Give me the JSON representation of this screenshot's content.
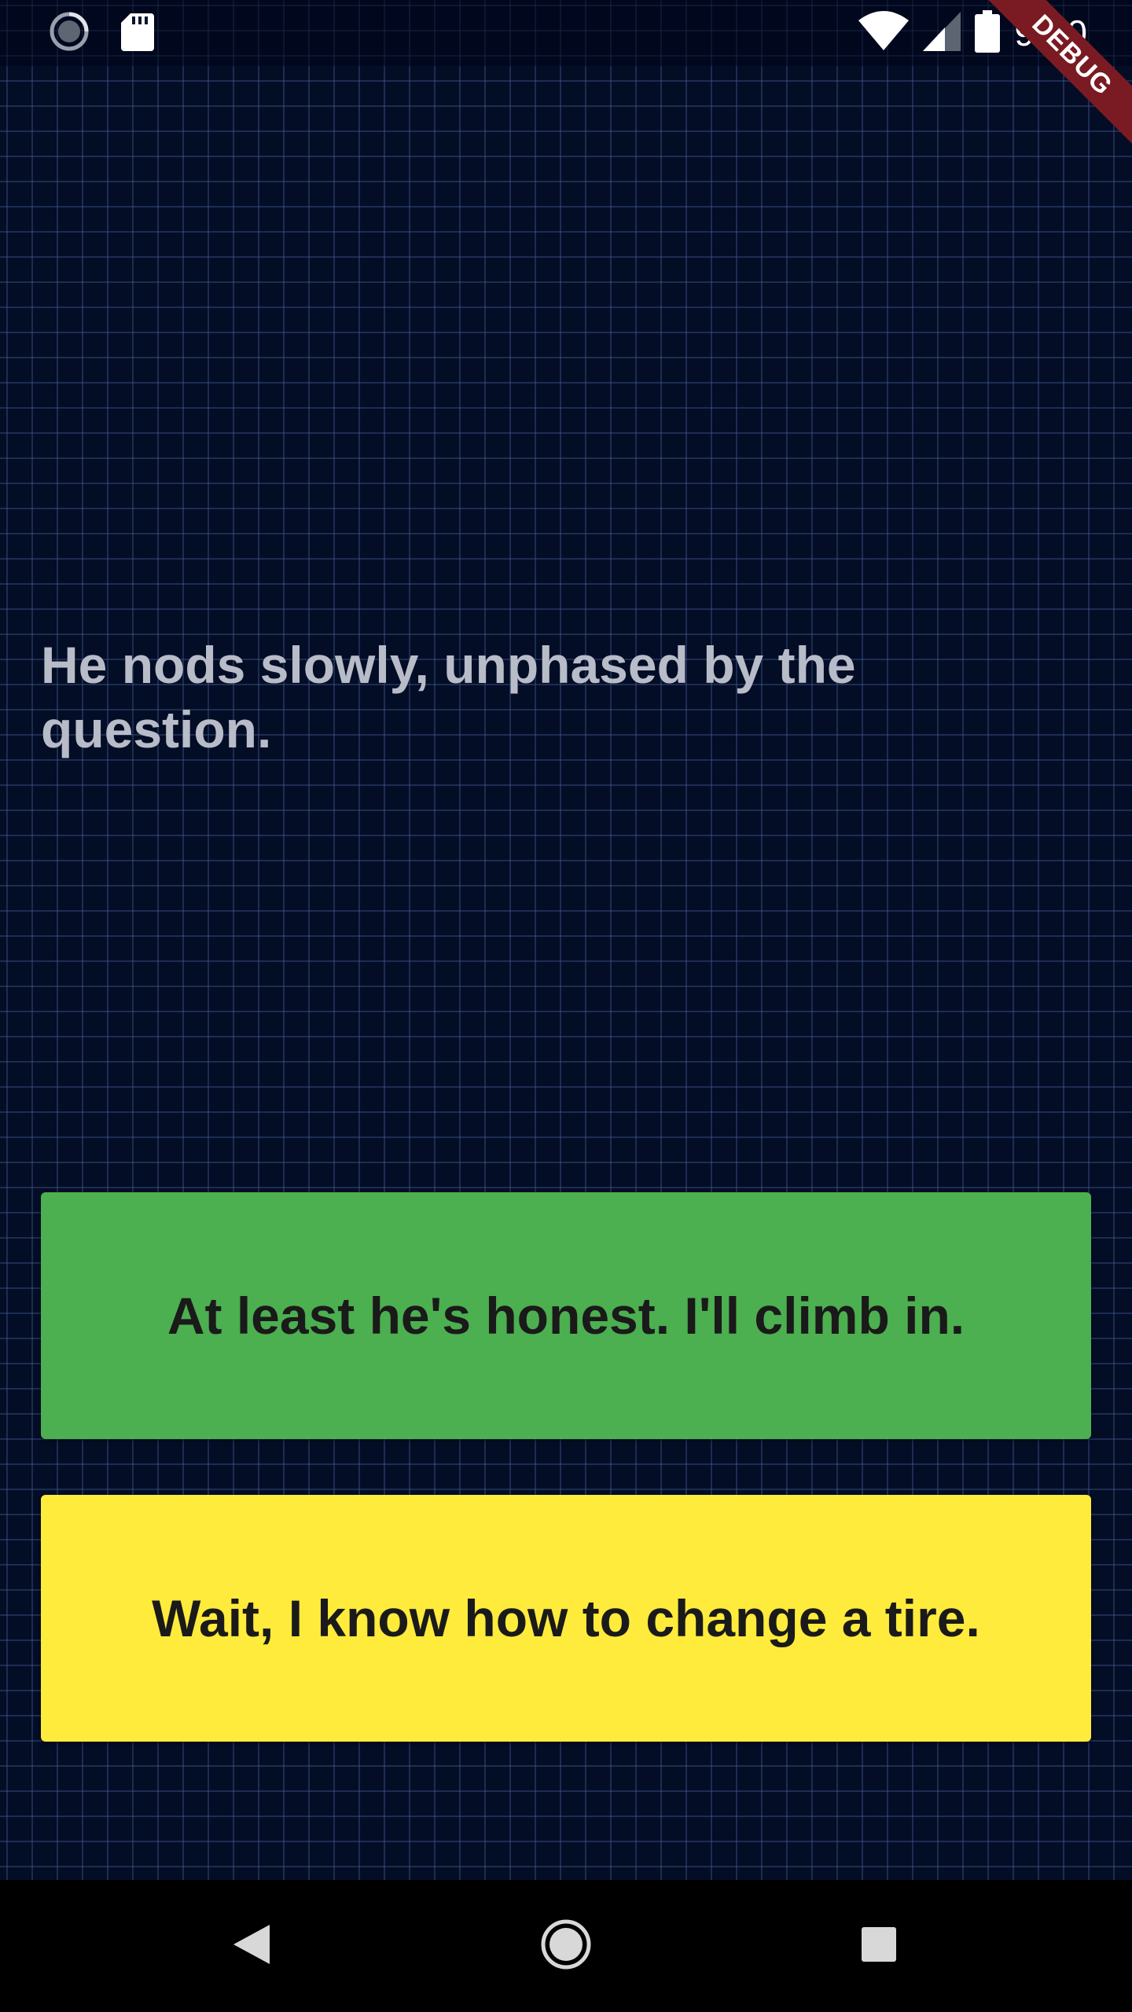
{
  "status_bar": {
    "time": "9:10",
    "icons": [
      "sync-icon",
      "sd-card-icon",
      "wifi-icon",
      "signal-icon",
      "battery-icon"
    ]
  },
  "debug_banner": {
    "label": "DEBUG",
    "color": "#7a1a22"
  },
  "story": {
    "text": "He nods slowly, unphased by the question."
  },
  "choices": [
    {
      "label": "At least he's honest. I'll climb in.",
      "color": "#4caf50"
    },
    {
      "label": "Wait, I know how to change a tire.",
      "color": "#ffeb3b"
    }
  ],
  "navigation": {
    "buttons": [
      "back-icon",
      "home-icon",
      "recents-icon"
    ]
  },
  "theme": {
    "background": "#030d26",
    "grid_line": "#465f96",
    "story_text": "#b8bcc8"
  }
}
